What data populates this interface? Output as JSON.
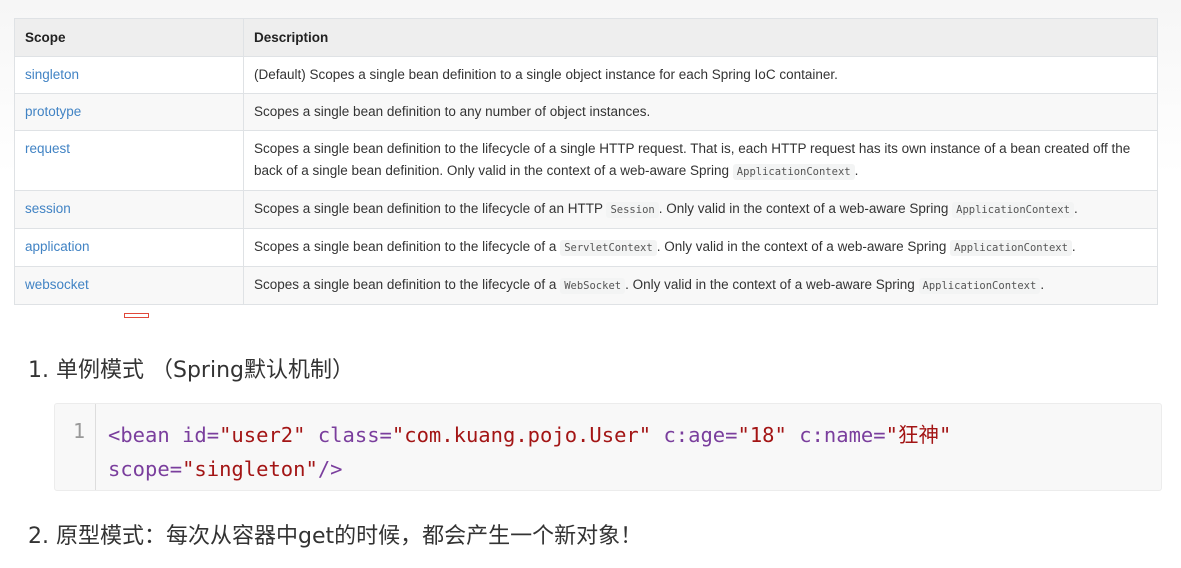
{
  "table": {
    "headers": {
      "scope": "Scope",
      "description": "Description"
    },
    "rows": [
      {
        "scope": "singleton",
        "desc": "(Default) Scopes a single bean definition to a single object instance for each Spring IoC container."
      },
      {
        "scope": "prototype",
        "desc": "Scopes a single bean definition to any number of object instances."
      },
      {
        "scope": "request",
        "desc_a": "Scopes a single bean definition to the lifecycle of a single HTTP request. That is, each HTTP request has its own instance of a bean created off the back of a single bean definition. Only valid in the context of a web-aware Spring ",
        "code_a": "ApplicationContext",
        "desc_b": "."
      },
      {
        "scope": "session",
        "desc_a": "Scopes a single bean definition to the lifecycle of an HTTP ",
        "code_a": "Session",
        "desc_b": ". Only valid in the context of a web-aware Spring ",
        "code_b": "ApplicationContext",
        "desc_c": "."
      },
      {
        "scope": "application",
        "desc_a": "Scopes a single bean definition to the lifecycle of a ",
        "code_a": "ServletContext",
        "desc_b": ". Only valid in the context of a web-aware Spring ",
        "code_b": "ApplicationContext",
        "desc_c": "."
      },
      {
        "scope": "websocket",
        "desc_a": "Scopes a single bean definition to the lifecycle of a ",
        "code_a": "WebSocket",
        "desc_b": ". Only valid in the context of a web-aware Spring ",
        "code_b": "ApplicationContext",
        "desc_c": "."
      }
    ]
  },
  "list": {
    "item1": "1. 单例模式 （Spring默认机制）",
    "item2": "2. 原型模式：每次从容器中get的时候，都会产生一个新对象！"
  },
  "code": {
    "line_number": "1",
    "open": "<bean",
    "id_attr": "id=",
    "id_val": "\"user2\"",
    "class_attr": "class=",
    "class_val": "\"com.kuang.pojo.User\"",
    "age_attr": "c:age=",
    "age_val": "\"18\"",
    "name_attr": "c:name=",
    "name_val": "\"狂神\"",
    "scope_attr": "scope=",
    "scope_val": "\"singleton\"",
    "close": "/>"
  },
  "colors": {
    "link": "#4183c4",
    "marker": "#e0483a"
  }
}
